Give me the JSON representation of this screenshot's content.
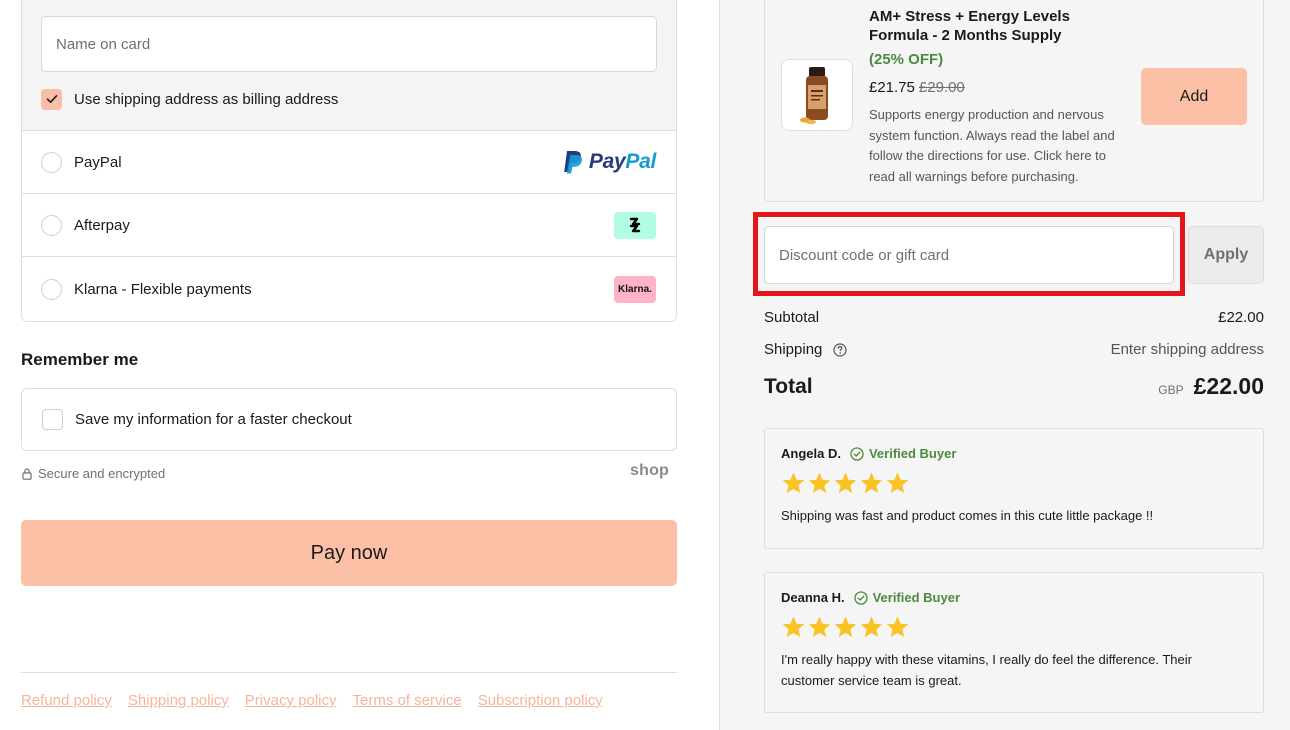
{
  "payment": {
    "name_on_card_placeholder": "Name on card",
    "billing_same_label": "Use shipping address as billing address",
    "methods": [
      {
        "label": "PayPal",
        "logo_text_1": "Pay",
        "logo_text_2": "Pal"
      },
      {
        "label": "Afterpay"
      },
      {
        "label": "Klarna - Flexible payments",
        "logo_text": "Klarna."
      }
    ]
  },
  "remember": {
    "title": "Remember me",
    "save_label": "Save my information for a faster checkout"
  },
  "secure": {
    "label": "Secure and encrypted",
    "shop_logo": "shop"
  },
  "pay_button_label": "Pay now",
  "footer": {
    "links": [
      "Refund policy",
      "Shipping policy",
      "Privacy policy",
      "Terms of service",
      "Subscription policy"
    ]
  },
  "upsell": {
    "title": "AM+ Stress + Energy Levels Formula - 2 Months Supply",
    "discount": "(25% OFF)",
    "price": "£21.75",
    "compare_price": "£29.00",
    "description": "Supports energy production and nervous system function. Always read the label and follow the directions for use. Click here to read all warnings before purchasing.",
    "add_label": "Add"
  },
  "discount": {
    "placeholder": "Discount code or gift card",
    "apply_label": "Apply"
  },
  "summary": {
    "subtotal_label": "Subtotal",
    "subtotal_value": "£22.00",
    "shipping_label": "Shipping",
    "shipping_value": "Enter shipping address",
    "total_label": "Total",
    "currency": "GBP",
    "total_value": "£22.00"
  },
  "reviews": [
    {
      "author": "Angela D.",
      "verified": "Verified Buyer",
      "rating": 5,
      "text": "Shipping was fast and product comes in this cute little package !!"
    },
    {
      "author": "Deanna H.",
      "verified": "Verified Buyer",
      "rating": 5,
      "text": "I'm really happy with these vitamins, I really do feel the difference. Their customer service team is great."
    }
  ],
  "colors": {
    "accent": "#fcc0a7",
    "verified_green": "#4c8a3d",
    "star_yellow": "#f7c325",
    "highlight_red": "#e3161c",
    "link_peach": "#f6b59b"
  }
}
